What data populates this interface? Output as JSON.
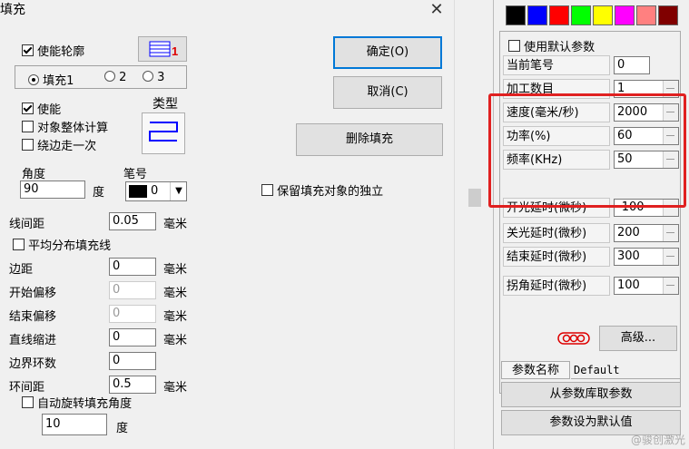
{
  "dialog": {
    "title": "填充",
    "enable_outline": "使能轮廓",
    "fill_tabs": [
      "填充1",
      "2",
      "3"
    ],
    "enable": "使能",
    "whole_calc": "对象整体计算",
    "edge_once": "绕边走一次",
    "type_label": "类型",
    "angle_label": "角度",
    "angle_value": "90",
    "angle_unit": "度",
    "pen_label": "笔号",
    "pen_value": "0",
    "line_spacing_label": "线间距",
    "line_spacing_value": "0.05",
    "unit_mm": "毫米",
    "avg_distribute": "平均分布填充线",
    "margin_label": "边距",
    "margin_value": "0",
    "start_offset_label": "开始偏移",
    "start_offset_value": "0",
    "end_offset_label": "结束偏移",
    "end_offset_value": "0",
    "line_indent_label": "直线缩进",
    "line_indent_value": "0",
    "border_loops_label": "边界环数",
    "border_loops_value": "0",
    "loop_spacing_label": "环间距",
    "loop_spacing_value": "0.5",
    "auto_rotate": "自动旋转填充角度",
    "rotate_value": "10",
    "rotate_unit": "度",
    "ok": "确定(O)",
    "cancel": "取消(C)",
    "delete_fill": "删除填充",
    "keep_independent": "保留填充对象的独立"
  },
  "params": {
    "swatches": [
      "#000000",
      "#0000ff",
      "#ff0000",
      "#00ff00",
      "#ffff00",
      "#ff00ff",
      "#ff8080",
      "#800000"
    ],
    "use_default": "使用默认参数",
    "rows": [
      {
        "label": "当前笔号",
        "value": "0"
      },
      {
        "label": "加工数目",
        "value": "1"
      },
      {
        "label": "速度(毫米/秒)",
        "value": "2000"
      },
      {
        "label": "功率(%)",
        "value": "60"
      },
      {
        "label": "频率(KHz)",
        "value": "50"
      },
      {
        "label": "开光延时(微秒)",
        "value": "-100"
      },
      {
        "label": "关光延时(微秒)",
        "value": "200"
      },
      {
        "label": "结束延时(微秒)",
        "value": "300"
      },
      {
        "label": "拐角延时(微秒)",
        "value": "100"
      }
    ],
    "advanced": "高级...",
    "param_name_label": "参数名称",
    "param_name_value": "Default",
    "from_lib": "从参数库取参数",
    "set_default": "参数设为默认值"
  },
  "watermark": "@骏创激光",
  "highlight_color": "#e02020"
}
